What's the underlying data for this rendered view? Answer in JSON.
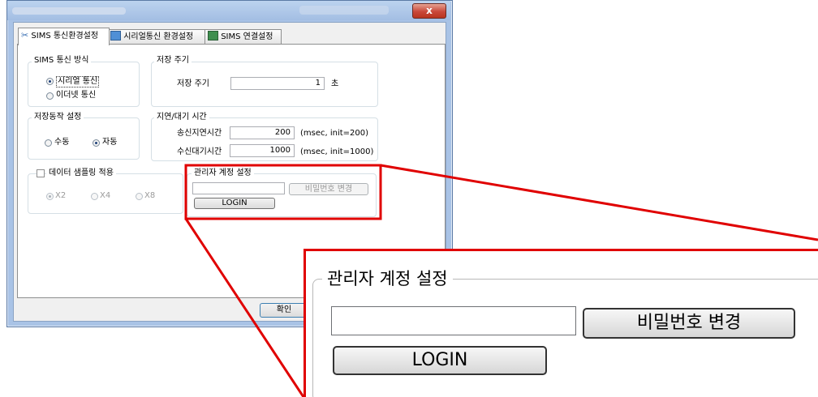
{
  "window": {
    "close_glyph": "x",
    "tabs": [
      {
        "label": "SIMS 통신환경설정",
        "icon": "tools-icon"
      },
      {
        "label": "시리얼통신 환경설정",
        "icon": "serial-icon"
      },
      {
        "label": "SIMS 연결설정",
        "icon": "network-icon"
      }
    ],
    "comm_method": {
      "title": "SIMS 통신 방식",
      "options": [
        {
          "label": "시리얼 통신",
          "selected": true
        },
        {
          "label": "이더넷 통신",
          "selected": false
        }
      ]
    },
    "save_period": {
      "title": "저장 주기",
      "label": "저장 주기",
      "value": "1",
      "unit": "초"
    },
    "save_action": {
      "title": "저장동작 설정",
      "options": [
        {
          "label": "수동",
          "selected": false
        },
        {
          "label": "자동",
          "selected": true
        }
      ]
    },
    "delay": {
      "title": "지연/대기 시간",
      "send_delay_label": "송신지연시간",
      "send_delay_value": "200",
      "send_delay_unit": "(msec, init=200)",
      "recv_wait_label": "수신대기시간",
      "recv_wait_value": "1000",
      "recv_wait_unit": "(msec, init=1000)"
    },
    "sampling": {
      "title": "데이터 샘플링 적용",
      "checked": false,
      "options": [
        {
          "label": "X2",
          "selected": true
        },
        {
          "label": "X4",
          "selected": false
        },
        {
          "label": "X8",
          "selected": false
        }
      ]
    },
    "admin": {
      "title": "관리자 계정 설정",
      "password_value": "",
      "change_password_label": "비밀번호 변경",
      "login_label": "LOGIN"
    },
    "ok_label": "확인"
  },
  "zoom": {
    "title": "관리자 계정 설정",
    "change_password_label": "비밀번호 변경",
    "login_label": "LOGIN"
  },
  "colors": {
    "highlight": "#e00000",
    "window_frame": "#a9c3e6",
    "close_button": "#c9483a"
  }
}
